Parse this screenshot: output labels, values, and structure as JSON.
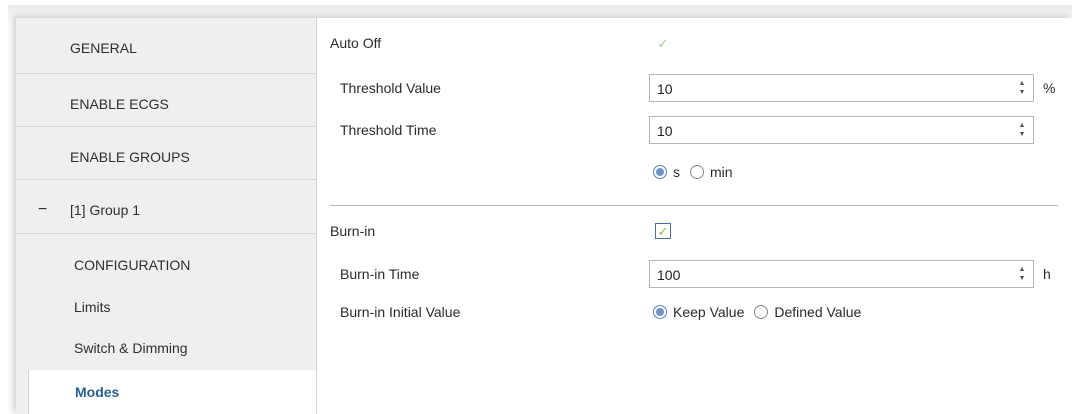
{
  "sidebar": {
    "items": [
      {
        "label": "GENERAL"
      },
      {
        "label": "ENABLE ECGS"
      },
      {
        "label": "ENABLE GROUPS"
      },
      {
        "label": "[1] Group 1",
        "collapse_glyph": "−"
      }
    ],
    "subitems": [
      {
        "label": "CONFIGURATION"
      },
      {
        "label": "Limits"
      },
      {
        "label": "Switch & Dimming"
      },
      {
        "label": "Modes"
      }
    ]
  },
  "main": {
    "auto_off": {
      "label": "Auto Off",
      "checked": true,
      "threshold_value": {
        "label": "Threshold Value",
        "value": "10",
        "unit": "%"
      },
      "threshold_time": {
        "label": "Threshold Time",
        "value": "10"
      },
      "time_unit_options": [
        {
          "label": "s",
          "selected": true
        },
        {
          "label": "min",
          "selected": false
        }
      ]
    },
    "burn_in": {
      "label": "Burn-in",
      "checked": true,
      "time": {
        "label": "Burn-in Time",
        "value": "100",
        "unit": "h"
      },
      "initial_value": {
        "label": "Burn-in Initial Value",
        "options": [
          {
            "label": "Keep Value",
            "selected": true
          },
          {
            "label": "Defined Value",
            "selected": false
          }
        ]
      }
    }
  },
  "glyphs": {
    "check": "✓",
    "spin_up": "▲",
    "spin_down": "▼"
  },
  "colors": {
    "accent": "#2a5f99",
    "check": "#7cbf4a"
  }
}
